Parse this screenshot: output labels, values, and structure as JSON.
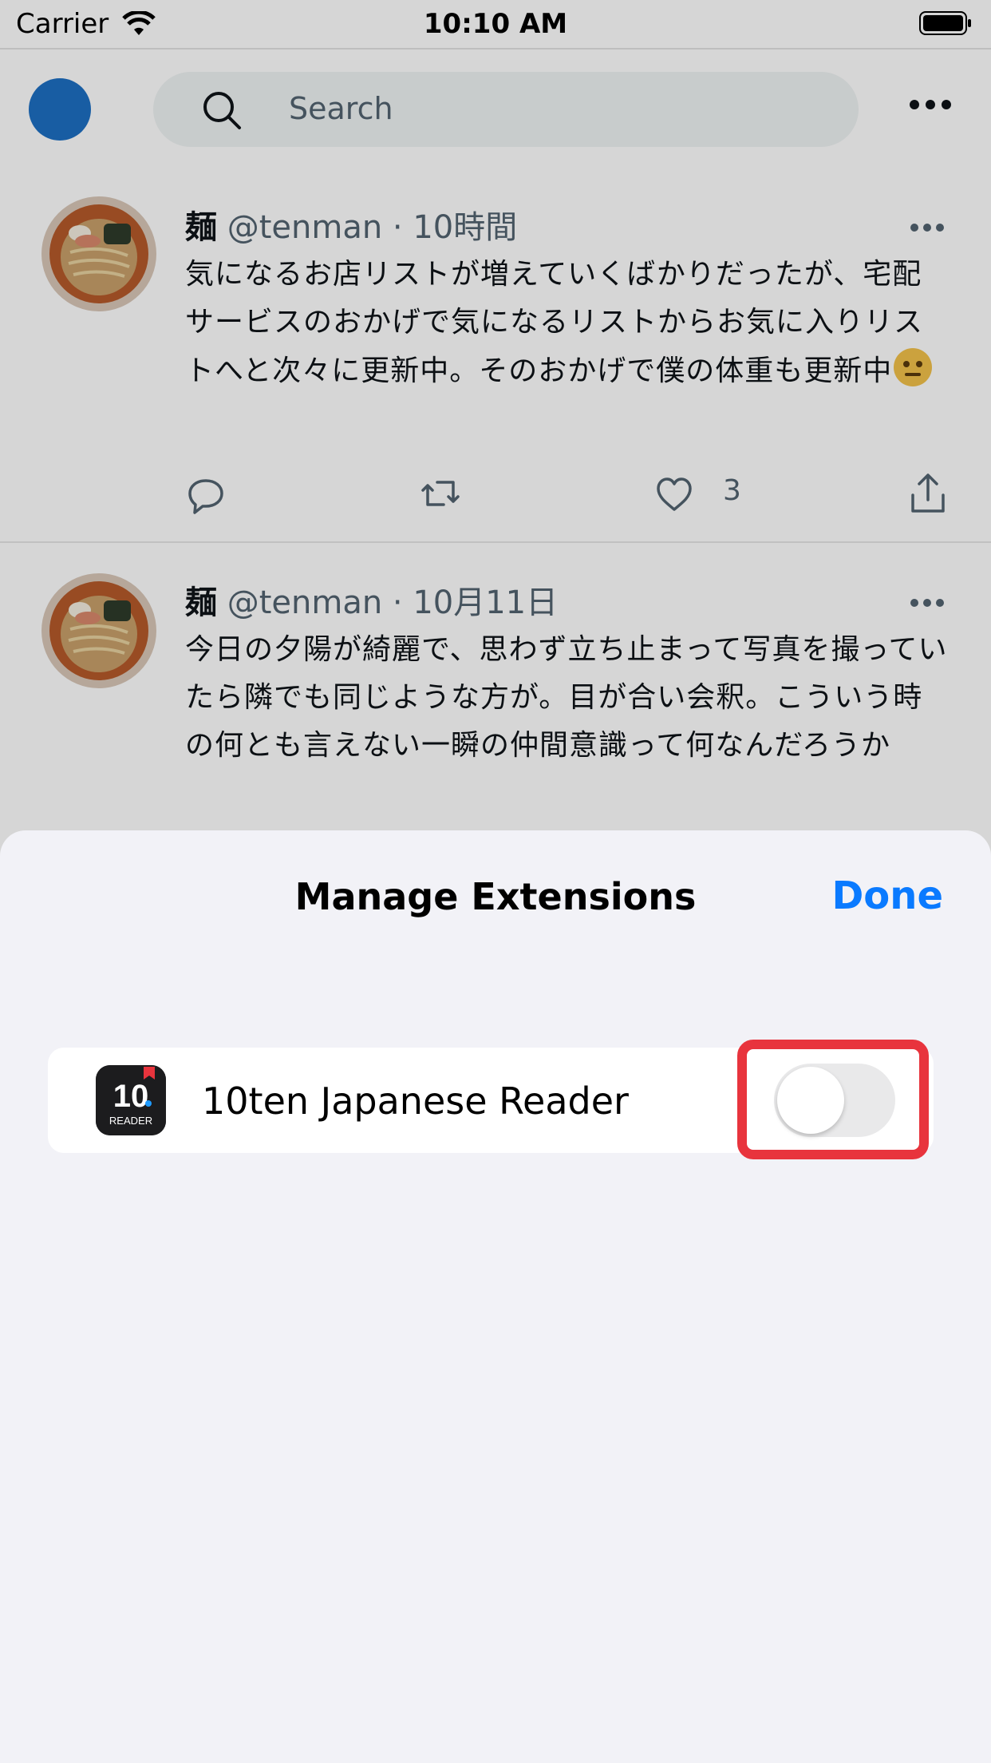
{
  "status_bar": {
    "carrier": "Carrier",
    "time": "10:10 AM"
  },
  "search": {
    "placeholder": "Search"
  },
  "tweets": [
    {
      "name": "麺",
      "meta": " @tenman · 10時間",
      "body": "気になるお店リストが増えていくばかりだったが、宅配サービスのおかげで気になるリストからお気に入りリストへと次々に更新中。そのおかげで僕の体重も更新中",
      "like_count": "3"
    },
    {
      "name": "麺",
      "meta": " @tenman · 10月11日",
      "body": "今日の夕陽が綺麗で、思わず立ち止まって写真を撮っていたら隣でも同じような方が。目が合い会釈。こういう時の何とも言えない一瞬の仲間意識って何なんだろうか"
    }
  ],
  "sheet": {
    "title": "Manage Extensions",
    "done_label": "Done",
    "extension": {
      "name": "10ten Japanese Reader",
      "icon_text": "10",
      "icon_sub": "READER",
      "enabled": false
    }
  },
  "colors": {
    "accent": "#0a7aff",
    "highlight": "#e8343d"
  }
}
